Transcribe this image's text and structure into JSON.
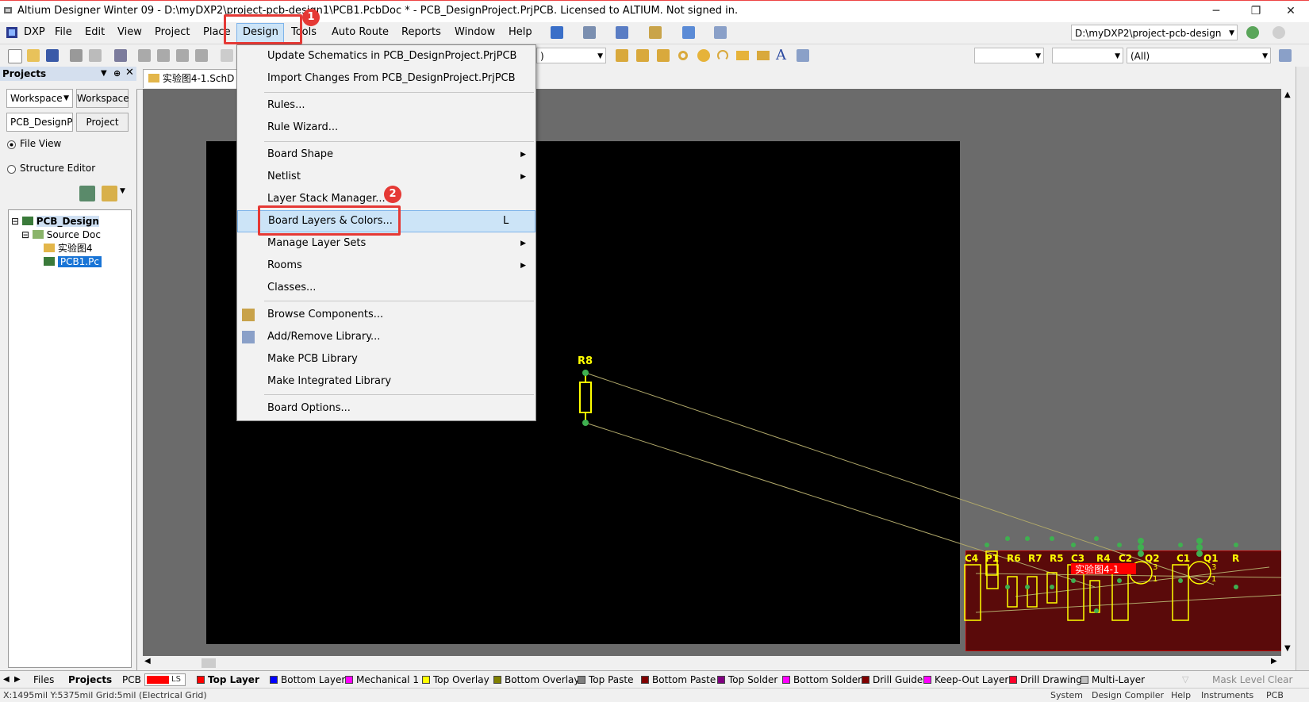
{
  "window": {
    "title": "Altium Designer Winter 09 - D:\\myDXP2\\project-pcb-design1\\PCB1.PcbDoc * - PCB_DesignProject.PrjPCB. Licensed to ALTIUM. Not signed in.",
    "controls": [
      "─",
      "❐",
      "✕"
    ]
  },
  "menubar": {
    "items": [
      "DXP",
      "File",
      "Edit",
      "View",
      "Project",
      "Place",
      "Design",
      "Tools",
      "Auto Route",
      "Reports",
      "Window",
      "Help"
    ],
    "path_combo": "D:\\myDXP2\\project-pcb-design"
  },
  "toolbar2": {
    "filter_combo": "(All)"
  },
  "left_panel": {
    "title": "Projects",
    "workspace_combo": "Workspace",
    "workspace_button": "Workspace",
    "project_field": "PCB_DesignPr",
    "project_button": "Project",
    "radio_file_view": "File View",
    "radio_structure_editor": "Structure Editor",
    "tree": {
      "project": "PCB_Design",
      "folder": "Source Doc",
      "schematic": "实验图4",
      "pcb": "PCB1.Pc"
    }
  },
  "doc_tab": "实验图4-1.SchD",
  "dropdown": {
    "items": [
      {
        "label": "Update Schematics in PCB_DesignProject.PrjPCB"
      },
      {
        "label": "Import Changes From PCB_DesignProject.PrjPCB"
      },
      {
        "label": "Rules..."
      },
      {
        "label": "Rule Wizard..."
      },
      {
        "label": "Board Shape"
      },
      {
        "label": "Netlist"
      },
      {
        "label": "Layer Stack Manager..."
      },
      {
        "label": "Board Layers & Colors...",
        "shortcut": "L"
      },
      {
        "label": "Manage Layer Sets"
      },
      {
        "label": "Rooms"
      },
      {
        "label": "Classes..."
      },
      {
        "label": "Browse Components..."
      },
      {
        "label": "Add/Remove Library..."
      },
      {
        "label": "Make PCB Library"
      },
      {
        "label": "Make Integrated Library"
      },
      {
        "label": "Board Options..."
      }
    ]
  },
  "annotations": {
    "badge1": "1",
    "badge2": "2"
  },
  "pcb": {
    "r8_label": "R8",
    "component_labels": [
      "C4",
      "P1",
      "R6",
      "R7",
      "R5",
      "C3",
      "R4",
      "C2",
      "Q2",
      "C1",
      "Q1",
      "R"
    ],
    "room_label": "实验图4-1",
    "pin_numbers": [
      "3",
      "3",
      "1",
      "1"
    ]
  },
  "layer_tabs": {
    "ls": "LS",
    "layers": [
      {
        "name": "Top Layer",
        "color": "#ff0000"
      },
      {
        "name": "Bottom Layer",
        "color": "#0000ff"
      },
      {
        "name": "Mechanical 1",
        "color": "#ff00ff"
      },
      {
        "name": "Top Overlay",
        "color": "#ffff00"
      },
      {
        "name": "Bottom Overlay",
        "color": "#808000"
      },
      {
        "name": "Top Paste",
        "color": "#808080"
      },
      {
        "name": "Bottom Paste",
        "color": "#800000"
      },
      {
        "name": "Top Solder",
        "color": "#800080"
      },
      {
        "name": "Bottom Solder",
        "color": "#ff00ff"
      },
      {
        "name": "Drill Guide",
        "color": "#800000"
      },
      {
        "name": "Keep-Out Layer",
        "color": "#ff00ff"
      },
      {
        "name": "Drill Drawing",
        "color": "#ff002a"
      },
      {
        "name": "Multi-Layer",
        "color": "#c0c0c0"
      }
    ],
    "mask_level": "Mask Level",
    "clear": "Clear"
  },
  "panel_tabs": [
    "Files",
    "Projects",
    "PCB"
  ],
  "statusbar": {
    "coords": "X:1495mil Y:5375mil   Grid:5mil    (Electrical Grid)",
    "right_items": [
      "System",
      "Design Compiler",
      "Help",
      "Instruments",
      "PCB"
    ]
  }
}
